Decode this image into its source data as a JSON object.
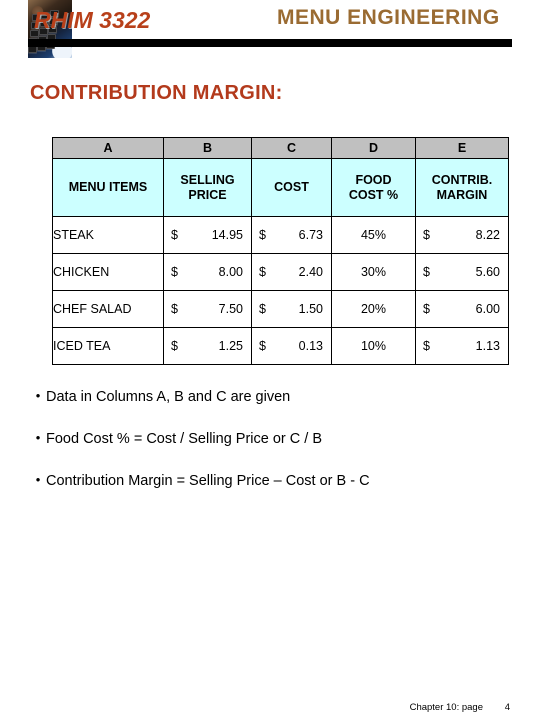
{
  "header": {
    "logo_title": "RHIM 3322",
    "logo_icon": "calculator-photo",
    "title": "MENU ENGINEERING",
    "rule_color": "#000000",
    "logo_text_color": "#b8401a",
    "title_color": "#9a6b32"
  },
  "slide": {
    "title": "CONTRIBUTION MARGIN:",
    "title_color": "#b33a1c"
  },
  "table": {
    "letter_row": [
      "A",
      "B",
      "C",
      "D",
      "E"
    ],
    "letter_row_bg": "#c0c0c0",
    "headings": [
      "MENU ITEMS",
      "SELLING PRICE",
      "COST",
      "FOOD COST %",
      "CONTRIB. MARGIN"
    ],
    "headings_bg": "#ccffff",
    "headings_lines": [
      [
        "MENU ITEMS"
      ],
      [
        "SELLING",
        "PRICE"
      ],
      [
        "COST"
      ],
      [
        "FOOD",
        "COST %"
      ],
      [
        "CONTRIB.",
        "MARGIN"
      ]
    ],
    "currency_symbol": "$",
    "rows": [
      {
        "item": "STEAK",
        "selling_price": "14.95",
        "cost": "6.73",
        "food_cost_pct": "45%",
        "contrib_margin": "8.22"
      },
      {
        "item": "CHICKEN",
        "selling_price": "8.00",
        "cost": "2.40",
        "food_cost_pct": "30%",
        "contrib_margin": "5.60"
      },
      {
        "item": "CHEF SALAD",
        "selling_price": "7.50",
        "cost": "1.50",
        "food_cost_pct": "20%",
        "contrib_margin": "6.00"
      },
      {
        "item": "ICED TEA",
        "selling_price": "1.25",
        "cost": "0.13",
        "food_cost_pct": "10%",
        "contrib_margin": "1.13"
      }
    ]
  },
  "bullets": {
    "marker": "•",
    "items": [
      "Data in Columns A, B and C are given",
      "Food Cost % = Cost / Selling Price or C / B",
      "Contribution Margin = Selling Price – Cost or B - C"
    ]
  },
  "footer": {
    "chapter": "Chapter 10: page",
    "page": "4"
  }
}
